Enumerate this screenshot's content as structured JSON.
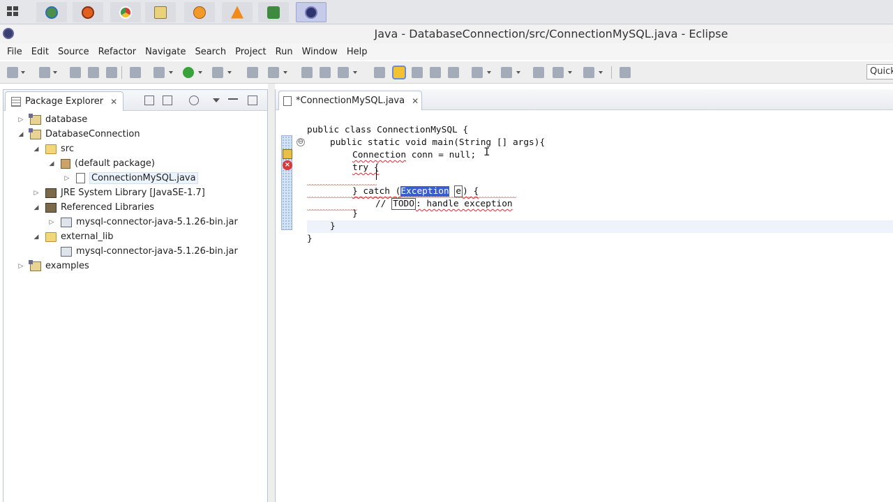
{
  "window": {
    "title": "Java - DatabaseConnection/src/ConnectionMySQL.java - Eclipse"
  },
  "menu": [
    "File",
    "Edit",
    "Source",
    "Refactor",
    "Navigate",
    "Search",
    "Project",
    "Run",
    "Window",
    "Help"
  ],
  "toolbar": {
    "quick_access": "Quick"
  },
  "explorer": {
    "tab_label": "Package Explorer",
    "close": "✕",
    "tree": [
      {
        "label": "database",
        "icon": "project-icon",
        "expanded": false
      },
      {
        "label": "DatabaseConnection",
        "icon": "project-icon",
        "expanded": true
      },
      {
        "label": "src",
        "icon": "source-folder-icon",
        "expanded": true
      },
      {
        "label": "(default package)",
        "icon": "package-icon",
        "expanded": true
      },
      {
        "label": "ConnectionMySQL.java",
        "icon": "java-file-icon",
        "expanded": false,
        "selected": true
      },
      {
        "label": "JRE System Library [JavaSE-1.7]",
        "icon": "library-icon",
        "expanded": false
      },
      {
        "label": "Referenced Libraries",
        "icon": "library-icon",
        "expanded": true
      },
      {
        "label": "mysql-connector-java-5.1.26-bin.jar",
        "icon": "jar-icon",
        "expanded": false
      },
      {
        "label": "external_lib",
        "icon": "folder-icon",
        "expanded": true
      },
      {
        "label": "mysql-connector-java-5.1.26-bin.jar",
        "icon": "jar-file-icon",
        "expanded": null
      },
      {
        "label": "examples",
        "icon": "project-icon",
        "expanded": false
      }
    ]
  },
  "editor": {
    "tab_label": "*ConnectionMySQL.java",
    "close": "✕",
    "code": {
      "l1": "public class ConnectionMySQL {",
      "l2": "public static void main(String [] args){",
      "l3a": "Connection",
      "l3b": " conn = null;",
      "l4": "try {",
      "l6a": "} catch (",
      "l6b": "Exception",
      "l6c": " ",
      "l6d": "e",
      "l6e": ") {",
      "l7a": "// ",
      "l7b": "TODO",
      "l7c": ": handle exception",
      "l8": "}",
      "l9": "}",
      "l10": "}"
    },
    "error_marker": "×",
    "fold_marker": "⊖"
  }
}
